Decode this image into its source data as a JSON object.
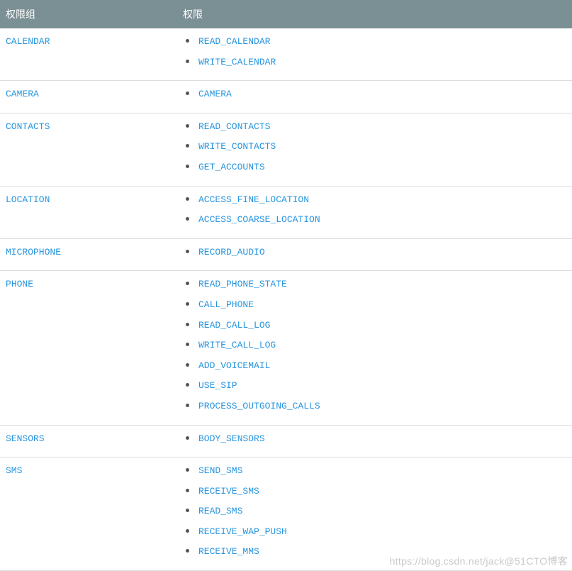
{
  "headers": {
    "group": "权限组",
    "permission": "权限"
  },
  "rows": [
    {
      "group": "CALENDAR",
      "permissions": [
        "READ_CALENDAR",
        "WRITE_CALENDAR"
      ]
    },
    {
      "group": "CAMERA",
      "permissions": [
        "CAMERA"
      ]
    },
    {
      "group": "CONTACTS",
      "permissions": [
        "READ_CONTACTS",
        "WRITE_CONTACTS",
        "GET_ACCOUNTS"
      ]
    },
    {
      "group": "LOCATION",
      "permissions": [
        "ACCESS_FINE_LOCATION",
        "ACCESS_COARSE_LOCATION"
      ]
    },
    {
      "group": "MICROPHONE",
      "permissions": [
        "RECORD_AUDIO"
      ]
    },
    {
      "group": "PHONE",
      "permissions": [
        "READ_PHONE_STATE",
        "CALL_PHONE",
        "READ_CALL_LOG",
        "WRITE_CALL_LOG",
        "ADD_VOICEMAIL",
        "USE_SIP",
        "PROCESS_OUTGOING_CALLS"
      ]
    },
    {
      "group": "SENSORS",
      "permissions": [
        "BODY_SENSORS"
      ]
    },
    {
      "group": "SMS",
      "permissions": [
        "SEND_SMS",
        "RECEIVE_SMS",
        "READ_SMS",
        "RECEIVE_WAP_PUSH",
        "RECEIVE_MMS"
      ]
    }
  ],
  "watermark": "https://blog.csdn.net/jack@51CTO博客"
}
